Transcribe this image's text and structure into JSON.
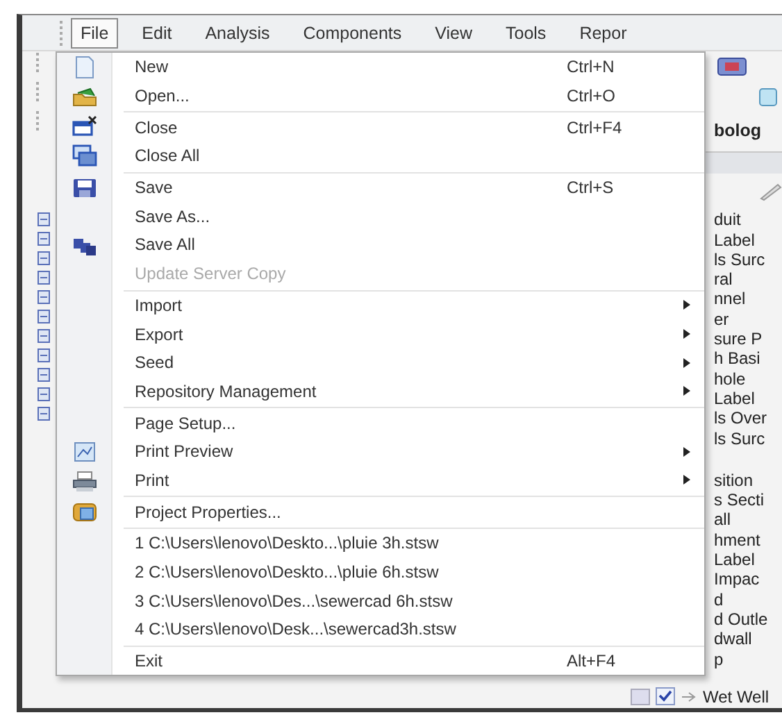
{
  "menu_bar": [
    {
      "label": "File",
      "selected": true
    },
    {
      "label": "Edit",
      "selected": false
    },
    {
      "label": "Analysis",
      "selected": false
    },
    {
      "label": "Components",
      "selected": false
    },
    {
      "label": "View",
      "selected": false
    },
    {
      "label": "Tools",
      "selected": false
    },
    {
      "label": "Repor",
      "selected": false
    }
  ],
  "file_menu": {
    "groups": [
      [
        {
          "label": "New",
          "shortcut": "Ctrl+N",
          "disabled": false,
          "has_submenu": false
        },
        {
          "label": "Open...",
          "shortcut": "Ctrl+O",
          "disabled": false,
          "has_submenu": false
        }
      ],
      [
        {
          "label": "Close",
          "shortcut": "Ctrl+F4",
          "disabled": false,
          "has_submenu": false
        },
        {
          "label": "Close All",
          "disabled": false,
          "has_submenu": false
        }
      ],
      [
        {
          "label": "Save",
          "shortcut": "Ctrl+S",
          "disabled": false,
          "has_submenu": false
        },
        {
          "label": "Save As...",
          "disabled": false,
          "has_submenu": false
        },
        {
          "label": "Save All",
          "disabled": false,
          "has_submenu": false
        },
        {
          "label": "Update Server Copy",
          "disabled": true,
          "has_submenu": false
        }
      ],
      [
        {
          "label": "Import",
          "disabled": false,
          "has_submenu": true
        },
        {
          "label": "Export",
          "disabled": false,
          "has_submenu": true
        },
        {
          "label": "Seed",
          "disabled": false,
          "has_submenu": true
        },
        {
          "label": "Repository Management",
          "disabled": false,
          "has_submenu": true
        }
      ],
      [
        {
          "label": "Page Setup...",
          "disabled": false,
          "has_submenu": false
        },
        {
          "label": "Print Preview",
          "disabled": false,
          "has_submenu": true
        },
        {
          "label": "Print",
          "disabled": false,
          "has_submenu": true
        }
      ],
      [
        {
          "label": "Project Properties...",
          "disabled": false,
          "has_submenu": false
        }
      ],
      [
        {
          "label": "1 C:\\Users\\lenovo\\Deskto...\\pluie 3h.stsw",
          "disabled": false,
          "has_submenu": false
        },
        {
          "label": "2 C:\\Users\\lenovo\\Deskto...\\pluie 6h.stsw",
          "disabled": false,
          "has_submenu": false
        },
        {
          "label": "3 C:\\Users\\lenovo\\Des...\\sewercad 6h.stsw",
          "disabled": false,
          "has_submenu": false
        },
        {
          "label": "4 C:\\Users\\lenovo\\Desk...\\sewercad3h.stsw",
          "disabled": false,
          "has_submenu": false
        }
      ],
      [
        {
          "label": "Exit",
          "shortcut": "Alt+F4",
          "disabled": false,
          "has_submenu": false
        }
      ]
    ]
  },
  "right_panel": {
    "title": "bolog",
    "tree_groups": [
      [
        "duit",
        "Label",
        "ls Surc",
        "ral",
        "nnel",
        "er",
        "sure P",
        "h Basi",
        "hole",
        "Label",
        "ls Over",
        "ls Surc"
      ],
      [
        "sition",
        "s Secti",
        "all",
        "hment",
        "Label",
        "Impac",
        "d",
        "d Outle",
        "dwall",
        "p"
      ]
    ],
    "bottom_item": {
      "label": "Wet Well",
      "checked": true
    }
  }
}
